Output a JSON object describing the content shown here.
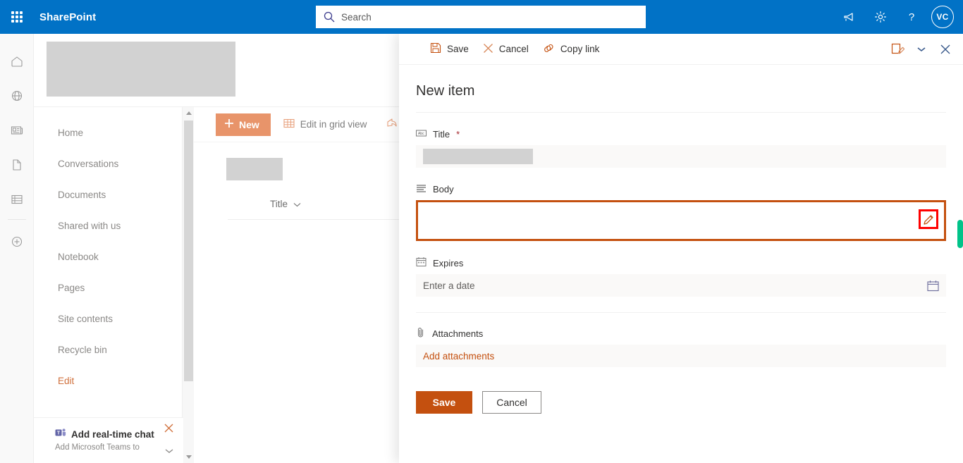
{
  "suite": {
    "waffle_label": "app-launcher",
    "brand": "SharePoint",
    "search_placeholder": "Search",
    "search_value": "",
    "megaphone_label": "announcements",
    "settings_label": "settings",
    "help_label": "help",
    "avatar_initials": "VC",
    "bar_color": "#0172c6"
  },
  "rail": {
    "items": [
      {
        "icon": "home-icon",
        "label": "Home"
      },
      {
        "icon": "globe-icon",
        "label": "Sites"
      },
      {
        "icon": "news-icon",
        "label": "News"
      },
      {
        "icon": "document-icon",
        "label": "Files"
      },
      {
        "icon": "list-icon",
        "label": "Lists"
      },
      {
        "icon": "plus-circle-icon",
        "label": "Create"
      }
    ]
  },
  "leftnav": {
    "items": [
      {
        "label": "Home",
        "accent": false
      },
      {
        "label": "Conversations",
        "accent": false
      },
      {
        "label": "Documents",
        "accent": false
      },
      {
        "label": "Shared with us",
        "accent": false
      },
      {
        "label": "Notebook",
        "accent": false
      },
      {
        "label": "Pages",
        "accent": false
      },
      {
        "label": "Site contents",
        "accent": false
      },
      {
        "label": "Recycle bin",
        "accent": false
      },
      {
        "label": "Edit",
        "accent": true
      }
    ]
  },
  "promo": {
    "title": "Add real-time chat",
    "subtitle": "Add Microsoft Teams to",
    "close_label": "dismiss"
  },
  "list": {
    "new_button": "New",
    "edit_grid": "Edit in grid view",
    "column_title": "Title"
  },
  "panel": {
    "toolbar": {
      "save": "Save",
      "cancel": "Cancel",
      "copy_link": "Copy link"
    },
    "heading": "New item",
    "fields": [
      {
        "name": "title",
        "label": "Title",
        "required": true,
        "icon": "abc-text-icon",
        "value": "",
        "placeholder": ""
      },
      {
        "name": "body",
        "label": "Body",
        "required": false,
        "icon": "multiline-text-icon",
        "value": "",
        "placeholder": "",
        "highlighted": true,
        "accent_color": "#c4500f"
      },
      {
        "name": "expires",
        "label": "Expires",
        "required": false,
        "icon": "calendar-icon",
        "value": "",
        "placeholder": "Enter a date"
      },
      {
        "name": "attachments",
        "label": "Attachments",
        "required": false,
        "icon": "paperclip-icon",
        "action_label": "Add attachments"
      }
    ],
    "actions": {
      "save": "Save",
      "cancel": "Cancel"
    },
    "accent_color": "#c4500f",
    "highlight_color": "#ff0000"
  }
}
